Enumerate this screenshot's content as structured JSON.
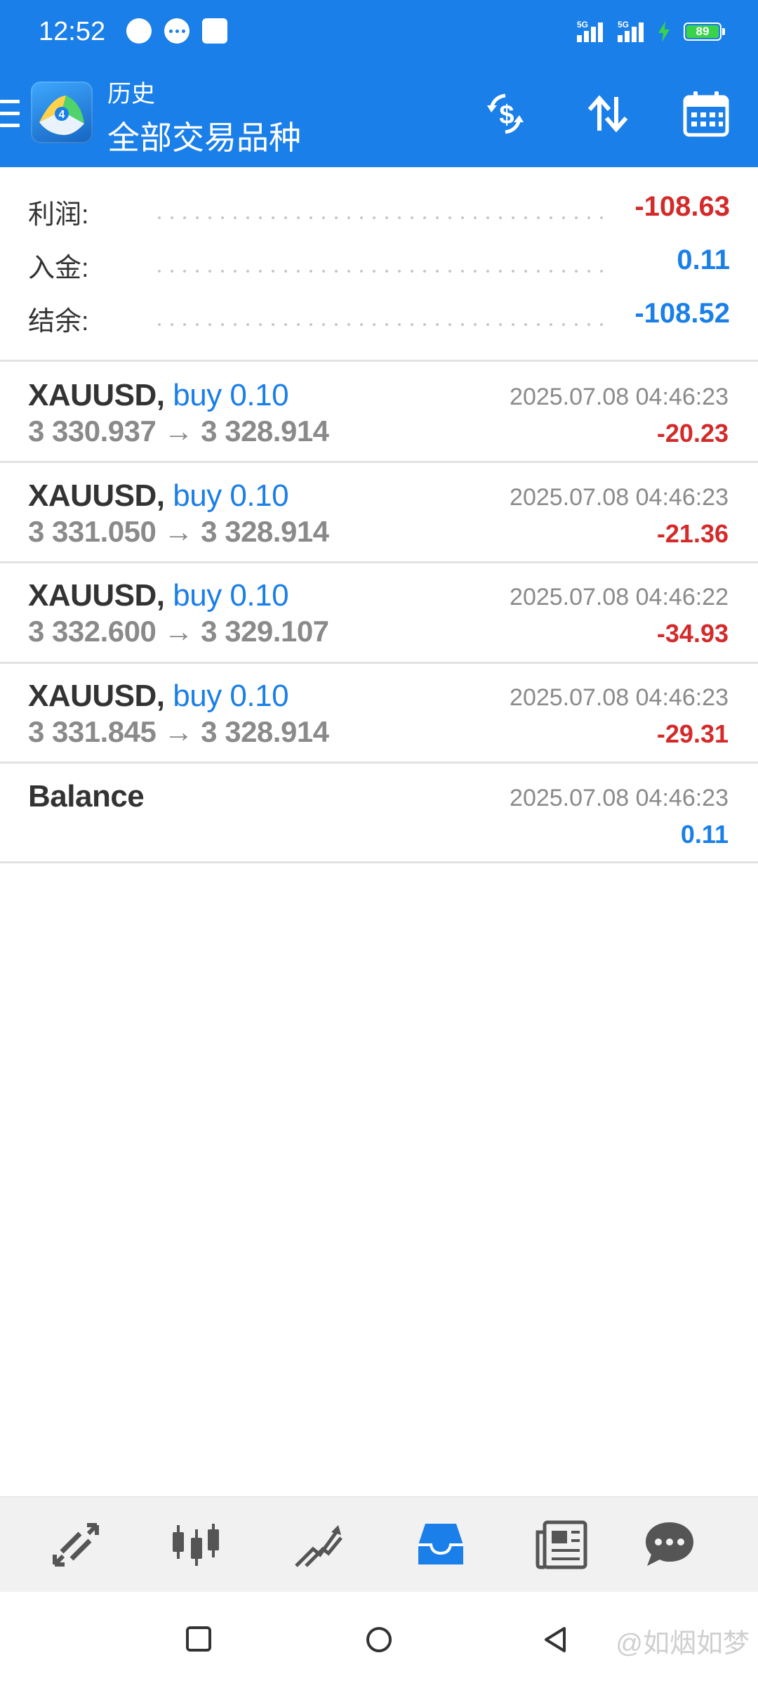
{
  "status_bar": {
    "time": "12:52",
    "network_1": "5G",
    "network_2": "5G",
    "battery": "89"
  },
  "header": {
    "subtitle": "历史",
    "title": "全部交易品种"
  },
  "summary": {
    "profit_label": "利润:",
    "profit_value": "-108.63",
    "deposit_label": "入金:",
    "deposit_value": "0.11",
    "balance_label": "结余:",
    "balance_value": "-108.52"
  },
  "deals": [
    {
      "symbol": "XAUUSD,",
      "side": "buy 0.10",
      "prices": "3 330.937 → 3 328.914",
      "time": "2025.07.08 04:46:23",
      "pl": "-20.23"
    },
    {
      "symbol": "XAUUSD,",
      "side": "buy 0.10",
      "prices": "3 331.050 → 3 328.914",
      "time": "2025.07.08 04:46:23",
      "pl": "-21.36"
    },
    {
      "symbol": "XAUUSD,",
      "side": "buy 0.10",
      "prices": "3 332.600 → 3 329.107",
      "time": "2025.07.08 04:46:22",
      "pl": "-34.93"
    },
    {
      "symbol": "XAUUSD,",
      "side": "buy 0.10",
      "prices": "3 331.845 → 3 328.914",
      "time": "2025.07.08 04:46:23",
      "pl": "-29.31"
    }
  ],
  "balance_row": {
    "label": "Balance",
    "time": "2025.07.08 04:46:23",
    "value": "0.11"
  },
  "bottom_nav": [
    {
      "icon": "quotes-icon"
    },
    {
      "icon": "chart-icon"
    },
    {
      "icon": "trade-icon"
    },
    {
      "icon": "history-icon",
      "active": true
    },
    {
      "icon": "news-icon"
    },
    {
      "icon": "chat-icon"
    }
  ],
  "watermark": "@如烟如梦",
  "colors": {
    "primary": "#1a7fe8",
    "loss": "#d42a2a",
    "muted": "#8a8a8a"
  }
}
